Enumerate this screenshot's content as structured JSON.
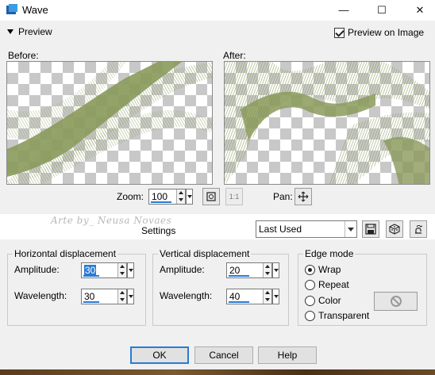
{
  "window": {
    "title": "Wave",
    "minimize": "—",
    "maximize": "☐",
    "close": "✕"
  },
  "preview": {
    "toggle_label": "Preview",
    "on_image_label": "Preview on Image",
    "on_image_checked": true,
    "before_label": "Before:",
    "after_label": "After:"
  },
  "zoom": {
    "label": "Zoom:",
    "value": "100",
    "pan_label": "Pan:",
    "fit_icon": "zoom-fit-icon",
    "actual_icon": "one-to-one-icon",
    "pan_icon": "move-icon"
  },
  "watermark": "Arte by_ Neusa Novaes",
  "settings": {
    "label": "Settings",
    "preset_value": "Last Used"
  },
  "horizontal": {
    "title": "Horizontal displacement",
    "amplitude_label": "Amplitude:",
    "amplitude": "30",
    "wavelength_label": "Wavelength:",
    "wavelength": "30"
  },
  "vertical": {
    "title": "Vertical displacement",
    "amplitude_label": "Amplitude:",
    "amplitude": "20",
    "wavelength_label": "Wavelength:",
    "wavelength": "40"
  },
  "edge_mode": {
    "title": "Edge mode",
    "options": [
      "Wrap",
      "Repeat",
      "Color",
      "Transparent"
    ],
    "selected": "Wrap"
  },
  "buttons": {
    "ok": "OK",
    "cancel": "Cancel",
    "help": "Help"
  },
  "colors": {
    "accent": "#2a7bd4",
    "wave_green": "#8a9a5b"
  }
}
